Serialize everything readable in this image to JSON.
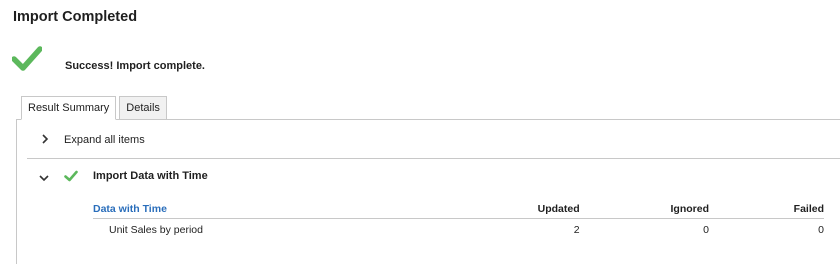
{
  "page": {
    "title": "Import Completed",
    "success_message": "Success! Import complete."
  },
  "tabs": [
    {
      "label": "Result Summary",
      "active": true
    },
    {
      "label": "Details",
      "active": false
    }
  ],
  "summary": {
    "expand_all_label": "Expand all items",
    "group": {
      "label": "Import Data with Time",
      "status": "success",
      "table": {
        "columns": [
          "Data with Time",
          "Updated",
          "Ignored",
          "Failed"
        ],
        "rows": [
          {
            "name": "Unit Sales by period",
            "updated": "2",
            "ignored": "0",
            "failed": "0"
          }
        ]
      }
    }
  },
  "colors": {
    "success_green": "#5cb85c",
    "link_blue": "#2a6ebb",
    "border": "#c8c8c8"
  },
  "icons": {
    "success": "checkmark-icon",
    "expand": "chevron-right-icon",
    "collapse": "chevron-down-icon"
  }
}
